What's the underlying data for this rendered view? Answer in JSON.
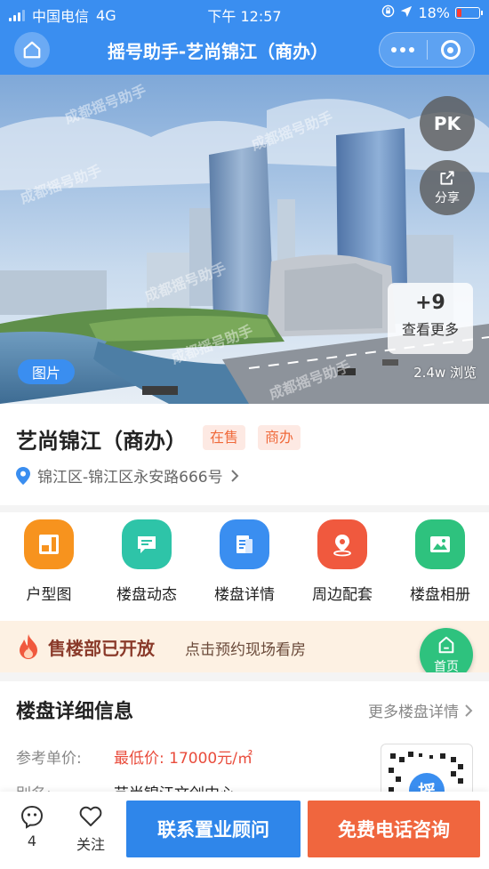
{
  "status_bar": {
    "carrier": "中国电信",
    "network": "4G",
    "time": "下午 12:57",
    "battery": "18%",
    "battery_level": 0.18
  },
  "nav": {
    "title": "摇号助手-艺尚锦江（商办）"
  },
  "hero": {
    "pk_label": "PK",
    "share_label": "分享",
    "more_count": "+9",
    "more_label": "查看更多",
    "views": "2.4w 浏览",
    "photo_tag": "图片",
    "watermark": "成都摇号助手"
  },
  "project": {
    "name": "艺尚锦江（商办）",
    "tags": [
      "在售",
      "商办"
    ],
    "address": "锦江区-锦江区永安路666号"
  },
  "features": [
    {
      "label": "户型图",
      "icon": "floorplan-icon",
      "color": "#f7931e"
    },
    {
      "label": "楼盘动态",
      "icon": "chat-icon",
      "color": "#2ec4a8"
    },
    {
      "label": "楼盘详情",
      "icon": "document-icon",
      "color": "#3a8ef0"
    },
    {
      "label": "周边配套",
      "icon": "location-icon",
      "color": "#f0593e"
    },
    {
      "label": "楼盘相册",
      "icon": "image-icon",
      "color": "#2ec27e"
    }
  ],
  "promo": {
    "title": "售楼部已开放",
    "subtitle": "点击预约现场看房"
  },
  "home_fab": {
    "label": "首页"
  },
  "detail": {
    "title": "楼盘详细信息",
    "more_link": "更多楼盘详情",
    "rows": [
      {
        "key": "参考单价:",
        "value": "最低价: 17000元/㎡"
      },
      {
        "key": "别名:",
        "value": "艺尚锦江文创中心"
      }
    ],
    "qr_char": "摇"
  },
  "bottom_bar": {
    "comments_count": "4",
    "follow_label": "关注",
    "consult_label": "联系置业顾问",
    "call_label": "免费电话咨询"
  },
  "colors": {
    "brand": "#3a8ef0",
    "accent": "#f0663e",
    "green": "#2ec27e"
  }
}
